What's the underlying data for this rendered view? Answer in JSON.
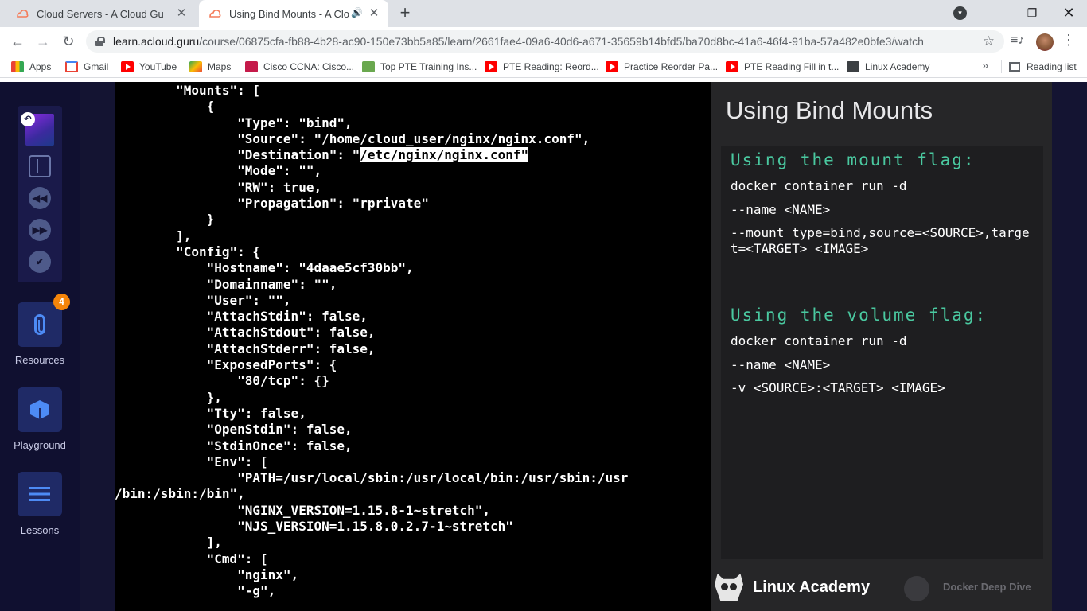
{
  "browser": {
    "tabs": [
      {
        "title": "Cloud Servers - A Cloud Guru"
      },
      {
        "title": "Using Bind Mounts - A Cloud Guru"
      }
    ],
    "url_host": "learn.acloud.guru",
    "url_path": "/course/06875cfa-fb88-4b28-ac90-150e73bb5a85/learn/2661fae4-09a6-40d6-a671-35659b14bfd5/ba70d8bc-41a6-46f4-91ba-57a482e0bfe3/watch",
    "bookmarks": [
      {
        "label": "Apps",
        "icon": "apps-icon"
      },
      {
        "label": "Gmail",
        "icon": "gmail-icon"
      },
      {
        "label": "YouTube",
        "icon": "youtube-icon"
      },
      {
        "label": "Maps",
        "icon": "maps-icon"
      },
      {
        "label": "Cisco CCNA: Cisco...",
        "icon": "cisco-icon"
      },
      {
        "label": "Top PTE Training Ins...",
        "icon": "pte-icon"
      },
      {
        "label": "PTE Reading: Reord...",
        "icon": "youtube-icon"
      },
      {
        "label": "Practice Reorder Pa...",
        "icon": "youtube-icon"
      },
      {
        "label": "PTE Reading Fill in t...",
        "icon": "youtube-icon"
      },
      {
        "label": "Linux Academy",
        "icon": "linux-academy-icon"
      }
    ],
    "reading_list": "Reading list"
  },
  "sidebar": {
    "resources_badge": "4",
    "resources_label": "Resources",
    "playground_label": "Playground",
    "lessons_label": "Lessons"
  },
  "terminal": {
    "lines": [
      "        \"Mounts\": [",
      "            {",
      "                \"Type\": \"bind\",",
      "                \"Source\": \"/home/cloud_user/nginx/nginx.conf\",",
      "                \"Destination\": \"",
      "                \"Mode\": \"\",",
      "                \"RW\": true,",
      "                \"Propagation\": \"rprivate\"",
      "            }",
      "        ],",
      "        \"Config\": {",
      "            \"Hostname\": \"4daae5cf30bb\",",
      "            \"Domainname\": \"\",",
      "            \"User\": \"\",",
      "            \"AttachStdin\": false,",
      "            \"AttachStdout\": false,",
      "            \"AttachStderr\": false,",
      "            \"ExposedPorts\": {",
      "                \"80/tcp\": {}",
      "            },",
      "            \"Tty\": false,",
      "            \"OpenStdin\": false,",
      "            \"StdinOnce\": false,",
      "            \"Env\": [",
      "                \"PATH=/usr/local/sbin:/usr/local/bin:/usr/sbin:/usr",
      "/bin:/sbin:/bin\",",
      "                \"NGINX_VERSION=1.15.8-1~stretch\",",
      "                \"NJS_VERSION=1.15.8.0.2.7-1~stretch\"",
      "            ],",
      "            \"Cmd\": [",
      "                \"nginx\",",
      "                \"-g\","
    ],
    "selected_text": "/etc/nginx/nginx.conf",
    "after_selection": "\""
  },
  "slide": {
    "title": "Using Bind Mounts",
    "mount_heading": "Using the mount flag:",
    "mount_cmd1": "docker container run -d",
    "mount_cmd2": "--name <NAME>",
    "mount_cmd3": "--mount type=bind,source=<SOURCE>,target=<TARGET> <IMAGE>",
    "volume_heading": "Using the volume flag:",
    "volume_cmd1": "docker container run -d",
    "volume_cmd2": "--name <NAME>",
    "volume_cmd3": "-v <SOURCE>:<TARGET> <IMAGE>",
    "brand": "Linux Academy",
    "course": "Docker Deep Dive"
  }
}
